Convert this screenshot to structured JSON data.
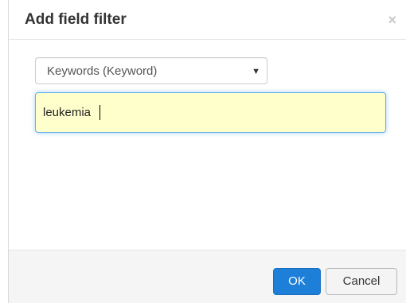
{
  "dialog": {
    "title": "Add field filter",
    "close_symbol": "×"
  },
  "field_select": {
    "selected": "Keywords (Keyword)",
    "arrow": "▼"
  },
  "value_input": {
    "value": "leukemia"
  },
  "footer": {
    "ok_label": "OK",
    "cancel_label": "Cancel"
  },
  "colors": {
    "primary_button": "#1e7fd8",
    "input_highlight_bg": "#ffffcc",
    "focus_border": "#66afe9"
  }
}
